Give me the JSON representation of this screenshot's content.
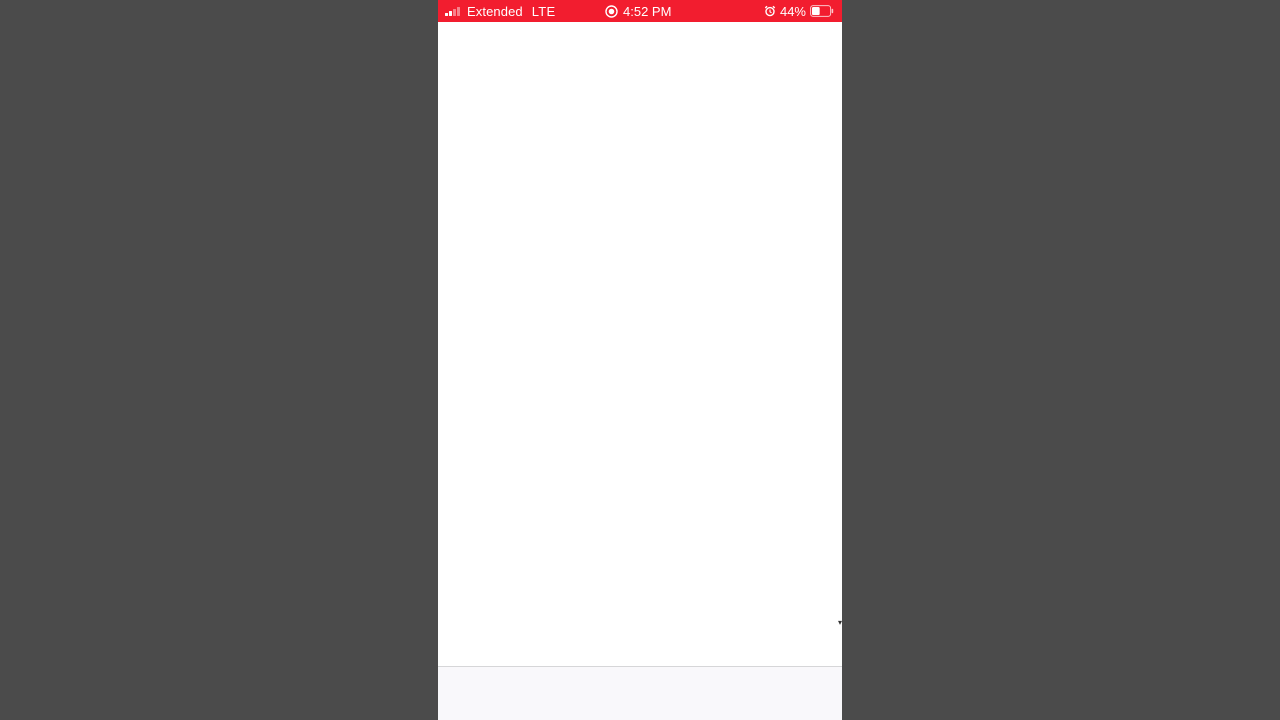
{
  "status_bar": {
    "background_color": "#f21d2f",
    "carrier": "Extended",
    "network": "LTE",
    "signal_bars_active": 2,
    "signal_bars_total": 4,
    "time": "4:52 PM",
    "recording_icon": "screen-recording-icon",
    "alarm_icon": "alarm-clock-icon",
    "battery_percent": "44%",
    "battery_level": 0.44
  },
  "content": {
    "background_color": "#ffffff"
  },
  "bottom_bar": {
    "background_color": "#f9f8fb"
  }
}
